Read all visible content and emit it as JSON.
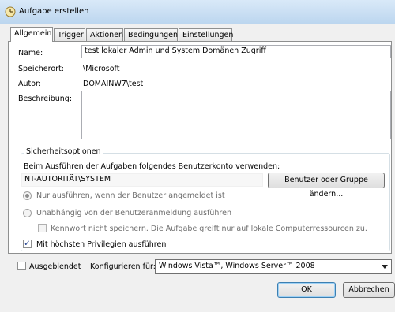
{
  "window": {
    "title": "Aufgabe erstellen",
    "icon": "clock-icon"
  },
  "tabs": [
    {
      "label": "Allgemein",
      "active": true
    },
    {
      "label": "Trigger",
      "active": false
    },
    {
      "label": "Aktionen",
      "active": false
    },
    {
      "label": "Bedingungen",
      "active": false
    },
    {
      "label": "Einstellungen",
      "active": false
    }
  ],
  "general": {
    "name_label": "Name:",
    "name_value": "test lokaler Admin und System Domänen Zugriff",
    "location_label": "Speicherort:",
    "location_value": "\\Microsoft",
    "author_label": "Autor:",
    "author_value": "DOMAINW7\\test",
    "description_label": "Beschreibung:",
    "description_value": ""
  },
  "security": {
    "group_title": "Sicherheitsoptionen",
    "account_prompt": "Beim Ausführen der Aufgaben folgendes Benutzerkonto verwenden:",
    "account_value": "NT-AUTORITÄT\\SYSTEM",
    "change_user_button": "Benutzer oder Gruppe ändern...",
    "radio_logged_on": "Nur ausführen, wenn der Benutzer angemeldet ist",
    "radio_independent": "Unabhängig von der Benutzeranmeldung ausführen",
    "no_password_checkbox": "Kennwort nicht speichern. Die Aufgabe greift nur auf lokale Computerressourcen zu.",
    "highest_privileges_checkbox": "Mit höchsten Privilegien ausführen",
    "highest_privileges_checked": true
  },
  "footer": {
    "hidden_checkbox": "Ausgeblendet",
    "configure_label": "Konfigurieren für:",
    "configure_value": "Windows Vista™, Windows Server™ 2008",
    "ok_button": "OK",
    "cancel_button": "Abbrechen"
  }
}
